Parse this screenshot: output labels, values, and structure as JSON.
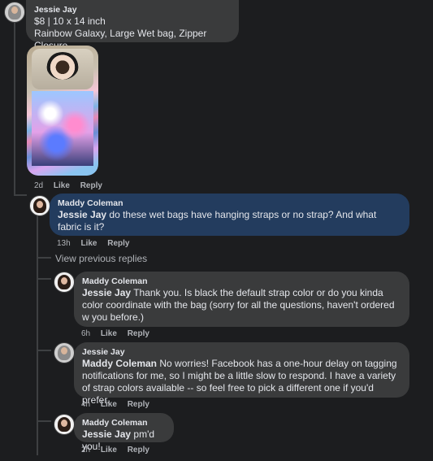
{
  "thread": [
    {
      "id": "c1",
      "author": "Jessie Jay",
      "lines": [
        "$8 | 10 x 14 inch",
        "Rainbow Galaxy, Large Wet bag, Zipper Closure"
      ],
      "time": "2d",
      "like": "Like",
      "reply": "Reply"
    },
    {
      "id": "c2",
      "author": "Maddy Coleman",
      "tag": "Jessie Jay",
      "text": "do these wet bags have hanging straps or no strap? And what fabric is it?",
      "time": "13h",
      "like": "Like",
      "reply": "Reply"
    },
    {
      "id": "view_prev",
      "label": "View previous replies"
    },
    {
      "id": "c3",
      "author": "Maddy Coleman",
      "tag": "Jessie Jay",
      "text": "Thank you. Is black the default strap color or do you kinda color coordinate with the bag (sorry for all the questions, haven't ordered w you before.)",
      "time": "6h",
      "like": "Like",
      "reply": "Reply"
    },
    {
      "id": "c4",
      "author": "Jessie Jay",
      "tag": "Maddy Coleman",
      "text": "No worries! Facebook has a one-hour delay on tagging notifications for me, so I might be a little slow to respond. I have a variety of strap colors available -- so feel free to pick a different one if you'd prefer.",
      "time": "4h",
      "like": "Like",
      "reply": "Reply"
    },
    {
      "id": "c5",
      "author": "Maddy Coleman",
      "tag": "Jessie Jay",
      "text": "pm'd you!",
      "time": "2h",
      "like": "Like",
      "reply": "Reply"
    }
  ],
  "colors": {
    "background": "#1c1d1f",
    "bubble": "#3a3b3c",
    "highlighted_bubble": "#233c5e",
    "secondary_text": "#b0b3b8"
  }
}
